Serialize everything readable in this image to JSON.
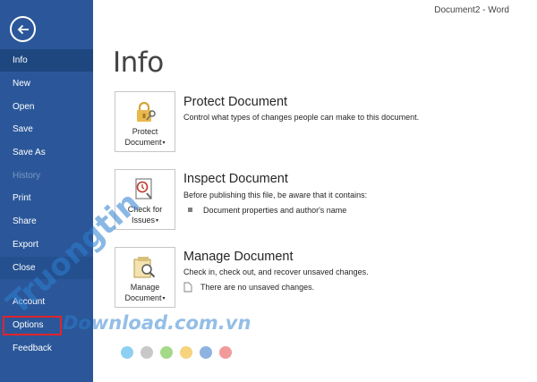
{
  "window": {
    "title": "Document2 - Word"
  },
  "sidebar": {
    "items": [
      {
        "label": "Info"
      },
      {
        "label": "New"
      },
      {
        "label": "Open"
      },
      {
        "label": "Save"
      },
      {
        "label": "Save As"
      },
      {
        "label": "History"
      },
      {
        "label": "Print"
      },
      {
        "label": "Share"
      },
      {
        "label": "Export"
      },
      {
        "label": "Close"
      },
      {
        "label": "Account"
      },
      {
        "label": "Options"
      },
      {
        "label": "Feedback"
      }
    ]
  },
  "main": {
    "title": "Info",
    "sections": [
      {
        "title": "Protect Document",
        "description": "Control what types of changes people can make to this document.",
        "button_line1": "Protect",
        "button_line2": "Document"
      },
      {
        "title": "Inspect Document",
        "description": "Before publishing this file, be aware that it contains:",
        "detail": "Document properties and author's name",
        "button_line1": "Check for",
        "button_line2": "Issues"
      },
      {
        "title": "Manage Document",
        "description": "Check in, check out, and recover unsaved changes.",
        "detail": "There are no unsaved changes.",
        "button_line1": "Manage",
        "button_line2": "Document"
      }
    ]
  },
  "watermark": {
    "text1": "Truongtin",
    "text2": "Download.com.vn",
    "dot_colors": [
      "#8fd0f2",
      "#c8c8c8",
      "#a5d98a",
      "#f7d27f",
      "#8fb3e0",
      "#f29a9a"
    ]
  },
  "colors": {
    "sidebar_bg": "#2b579a",
    "sidebar_selected": "#1e4780",
    "highlight_border": "#e0242c"
  }
}
